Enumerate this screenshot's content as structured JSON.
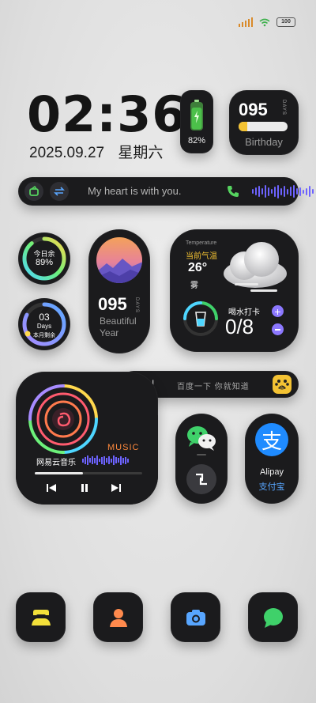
{
  "status_bar": {
    "battery_label": "100"
  },
  "clock": {
    "time": "02:36",
    "date": "2025.09.27",
    "weekday": "星期六"
  },
  "battery_widget": {
    "percent": "82%",
    "level": 0.82
  },
  "birthday_widget": {
    "days": "095",
    "unit": "DAYS",
    "label": "Birthday",
    "progress": 0.18
  },
  "message_bar": {
    "text": "My heart is with you."
  },
  "today_ring": {
    "line1": "今日余",
    "line2": "89%",
    "value": 0.89
  },
  "month_ring": {
    "value": "03",
    "unit": "Days",
    "caption": "本月剩余"
  },
  "day_widget": {
    "days": "095",
    "unit": "DAYS",
    "line1": "Beautiful",
    "line2": "Year"
  },
  "weather": {
    "title_en": "Temperature",
    "title_cn": "当前气温",
    "temp": "26°",
    "condition": "雾",
    "water_label": "喝水打卡",
    "water_value": "0/8"
  },
  "search_bar": {
    "cursor": "I",
    "placeholder": "百度一下 你就知道",
    "engine_badge": "du"
  },
  "music": {
    "tag": "MUSIC",
    "app_name": "网易云音乐",
    "progress": 0.45
  },
  "alipay": {
    "label_en": "Alipay",
    "label_cn": "支付宝",
    "glyph": "支"
  },
  "dock": {
    "items": [
      "contacts",
      "person",
      "camera",
      "messages"
    ]
  },
  "colors": {
    "accent_yellow": "#f3c233",
    "accent_purple": "#6d63ff",
    "accent_green": "#3fd16a",
    "alipay_blue": "#1f8bff",
    "music_orange": "#ff8a3d"
  }
}
